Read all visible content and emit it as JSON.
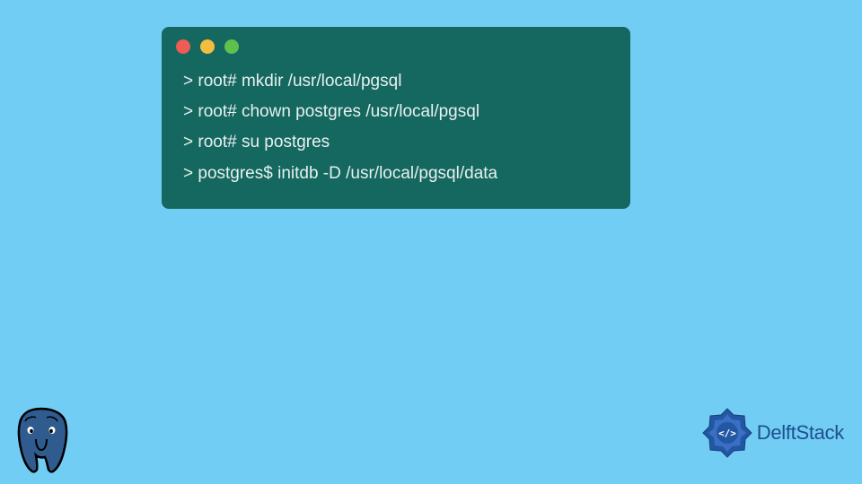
{
  "terminal": {
    "traffic_lights": {
      "red": "#ee5c54",
      "yellow": "#f5bd40",
      "green": "#5fc14c"
    },
    "lines": [
      "> root# mkdir /usr/local/pgsql",
      "> root# chown postgres /usr/local/pgsql",
      "> root# su postgres",
      "> postgres$ initdb -D /usr/local/pgsql/data"
    ]
  },
  "branding": {
    "delftstack_label": "DelftStack"
  },
  "colors": {
    "background": "#72cdf4",
    "terminal_bg": "#146860",
    "terminal_text": "#e8f0ef",
    "brand_blue": "#1d4f8c"
  }
}
